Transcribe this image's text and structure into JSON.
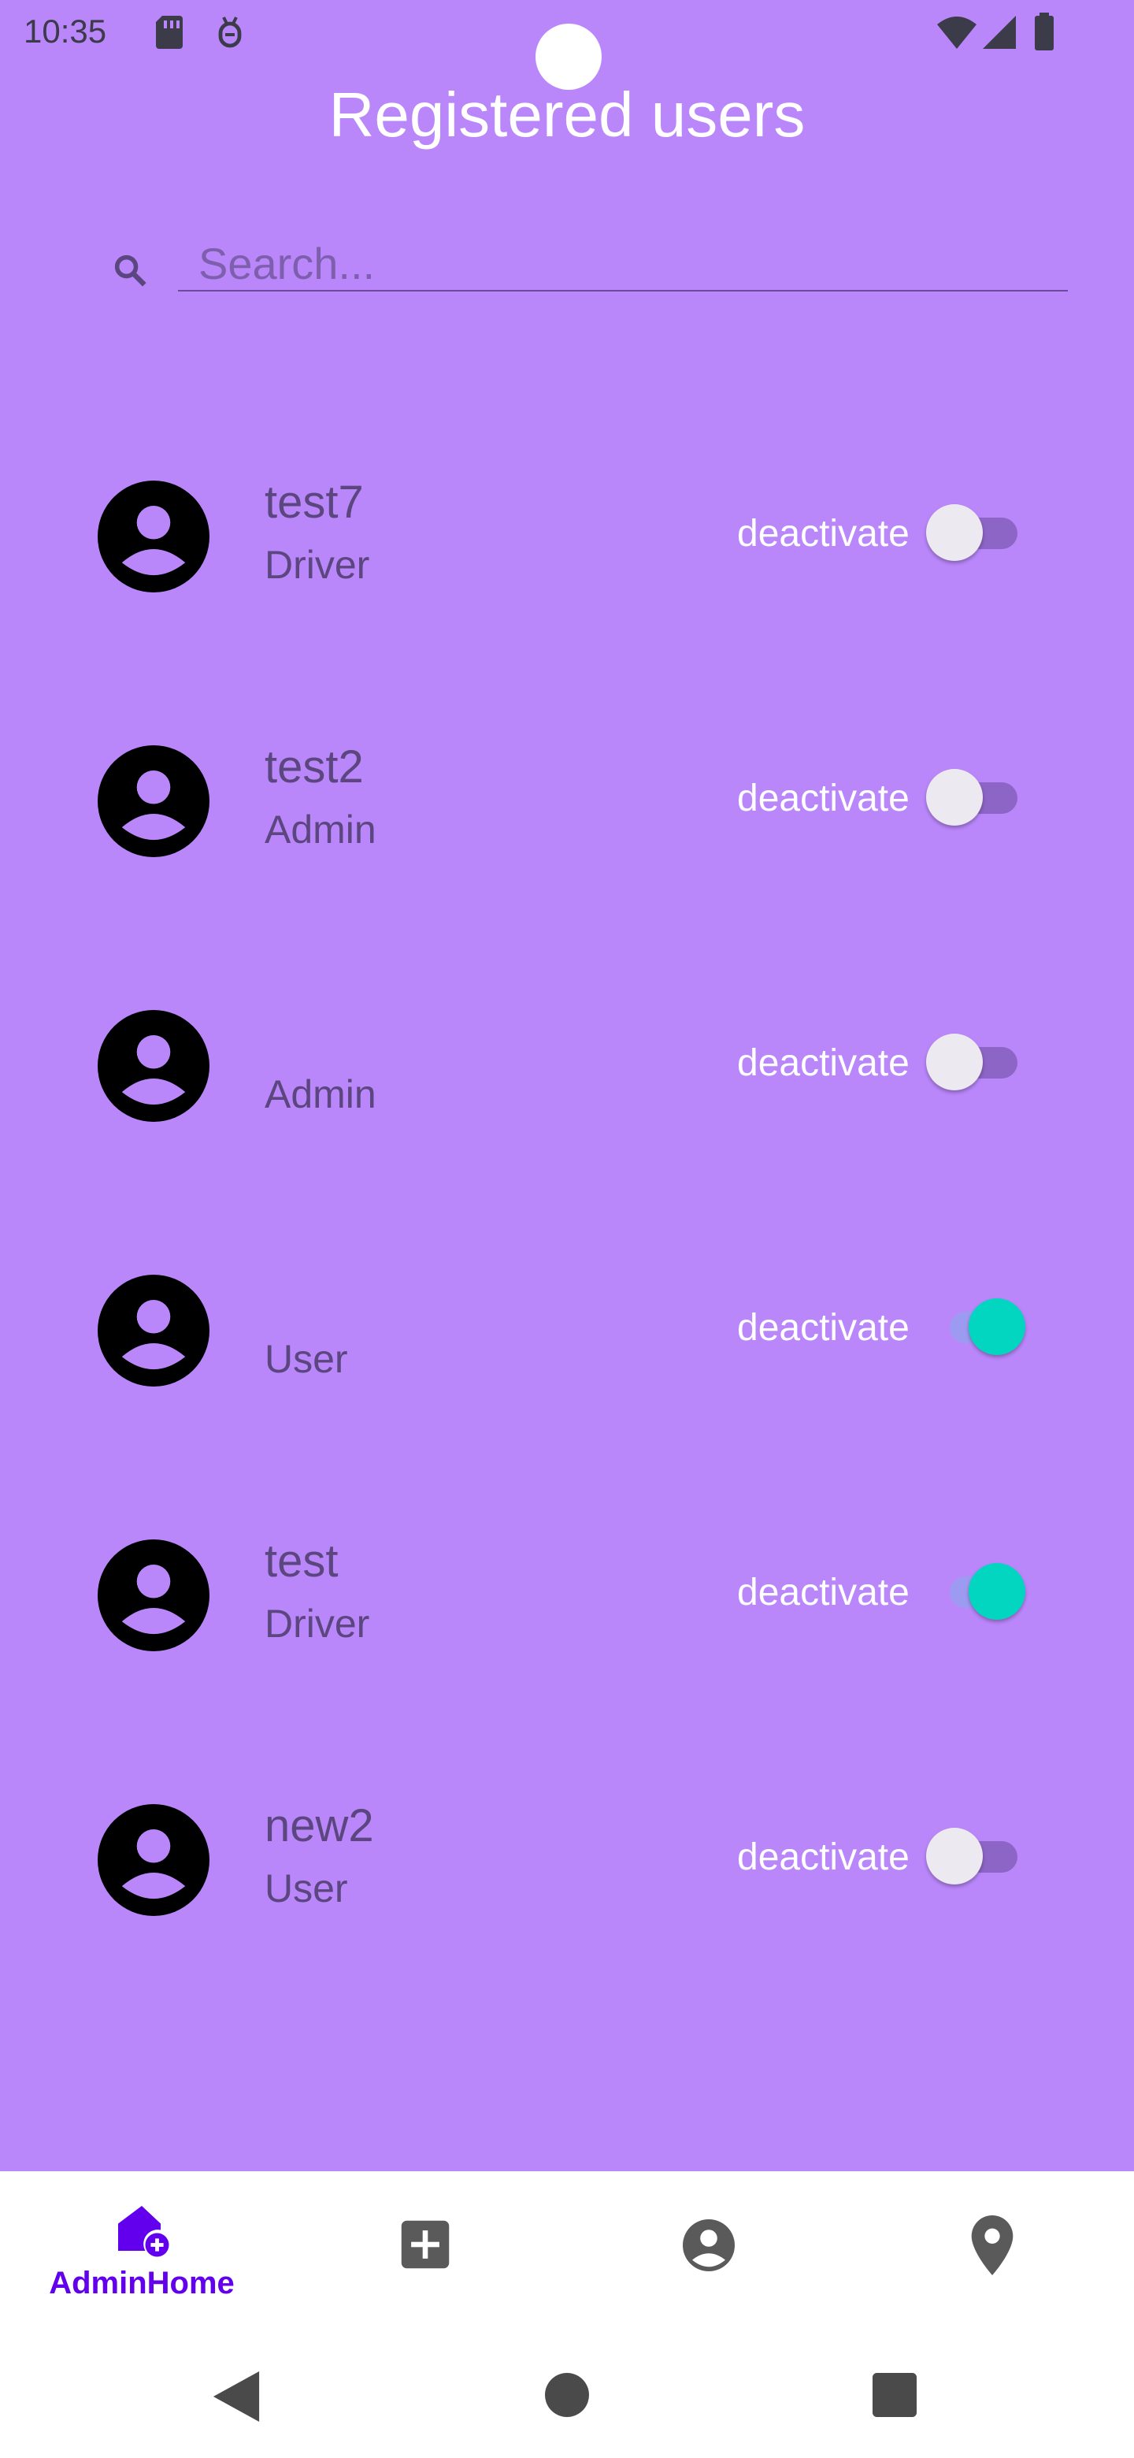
{
  "status_bar": {
    "time": "10:35",
    "icons": [
      "sd-card-icon",
      "debug-icon",
      "wifi-icon",
      "signal-icon",
      "battery-icon"
    ]
  },
  "header": {
    "title": "Registered users"
  },
  "search": {
    "placeholder": "Search...",
    "value": "",
    "icon": "search-icon"
  },
  "users": [
    {
      "name": "test7",
      "role": "Driver",
      "toggle_label": "deactivate",
      "active": false
    },
    {
      "name": "test2",
      "role": "Admin",
      "toggle_label": "deactivate",
      "active": false
    },
    {
      "name": "",
      "role": "Admin",
      "toggle_label": "deactivate",
      "active": false
    },
    {
      "name": "",
      "role": "User",
      "toggle_label": "deactivate",
      "active": true
    },
    {
      "name": "test",
      "role": "Driver",
      "toggle_label": "deactivate",
      "active": true
    },
    {
      "name": "new2",
      "role": "User",
      "toggle_label": "deactivate",
      "active": false
    }
  ],
  "bottom_nav": {
    "items": [
      {
        "label": "AdminHome",
        "icon": "admin-home-icon",
        "selected": true
      },
      {
        "label": "",
        "icon": "add-box-icon",
        "selected": false
      },
      {
        "label": "",
        "icon": "account-circle-icon",
        "selected": false
      },
      {
        "label": "",
        "icon": "location-pin-icon",
        "selected": false
      }
    ]
  },
  "system_nav": {
    "icons": [
      "back-icon",
      "home-icon",
      "recents-icon"
    ]
  },
  "colors": {
    "background": "#ba87fb",
    "accent": "#6200ee",
    "switch_on": "#03d6c0",
    "text_on_background": "#ffffff"
  }
}
